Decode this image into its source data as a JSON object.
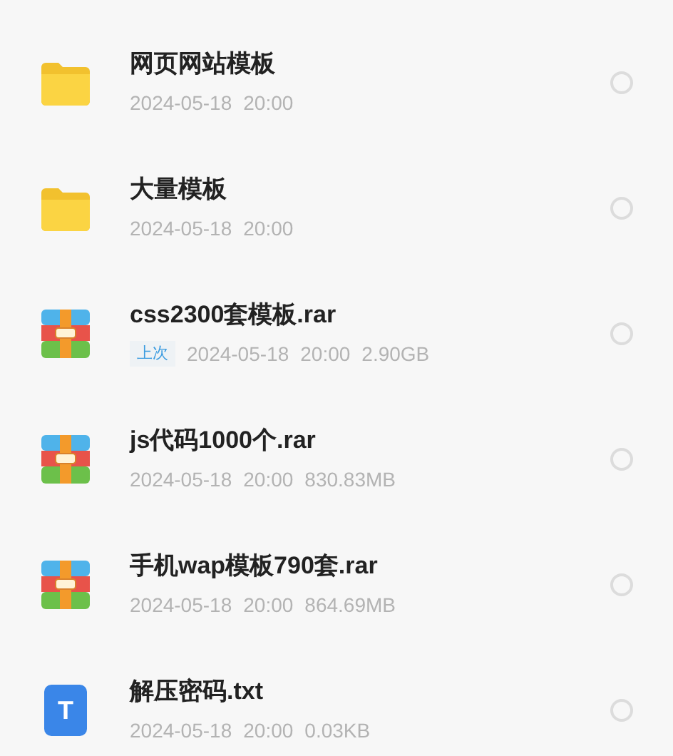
{
  "files": [
    {
      "kind": "folder",
      "name": "网页网站模板",
      "date": "2024-05-18",
      "time": "20:00",
      "selected": false
    },
    {
      "kind": "folder",
      "name": "大量模板",
      "date": "2024-05-18",
      "time": "20:00",
      "selected": false
    },
    {
      "kind": "archive",
      "name": "css2300套模板.rar",
      "tag": "上次",
      "date": "2024-05-18",
      "time": "20:00",
      "size": "2.90GB",
      "selected": false
    },
    {
      "kind": "archive",
      "name": "js代码1000个.rar",
      "date": "2024-05-18",
      "time": "20:00",
      "size": "830.83MB",
      "selected": false
    },
    {
      "kind": "archive",
      "name": "手机wap模板790套.rar",
      "date": "2024-05-18",
      "time": "20:00",
      "size": "864.69MB",
      "selected": false
    },
    {
      "kind": "text",
      "icon_text": "T",
      "name": "解压密码.txt",
      "date": "2024-05-18",
      "time": "20:00",
      "size": "0.03KB",
      "selected": false
    }
  ]
}
